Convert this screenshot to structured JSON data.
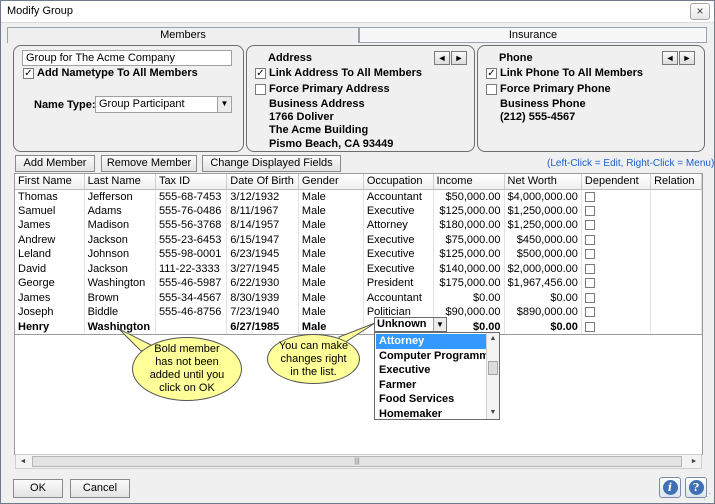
{
  "window": {
    "title": "Modify Group",
    "close_glyph": "×"
  },
  "tabs": [
    {
      "label": "Members",
      "active": true
    },
    {
      "label": "Insurance",
      "active": false
    }
  ],
  "group": {
    "name_value": "Group for The Acme Company",
    "add_nametype_label": "Add Nametype To All Members",
    "add_nametype_checked": true,
    "name_type_label": "Name Type:",
    "name_type_value": "Group Participant"
  },
  "address": {
    "title": "Address",
    "link_label": "Link Address To All Members",
    "link_checked": true,
    "primary_label": "Force Primary Address",
    "primary_checked": false,
    "type": "Business Address",
    "line1": "1766 Doliver",
    "line2": "The Acme Building",
    "line3": "Pismo Beach, CA  93449"
  },
  "phone": {
    "title": "Phone",
    "link_label": "Link Phone To All Members",
    "link_checked": true,
    "primary_label": "Force Primary Phone",
    "primary_checked": false,
    "type": "Business Phone",
    "number": "(212) 555-4567"
  },
  "toolbar": {
    "add_member": "Add Member",
    "remove_member": "Remove Member",
    "change_fields": "Change Displayed Fields",
    "hint": "(Left-Click = Edit, Right-Click = Menu)"
  },
  "table": {
    "columns": [
      "First Name",
      "Last Name",
      "Tax ID",
      "Date Of Birth",
      "Gender",
      "Occupation",
      "Income",
      "Net Worth",
      "Dependent",
      "Relation"
    ],
    "rows": [
      [
        "Thomas",
        "Jefferson",
        "555-68-7453",
        "3/12/1932",
        "Male",
        "Accountant",
        "$50,000.00",
        "$4,000,000.00"
      ],
      [
        "Samuel",
        "Adams",
        "555-76-0486",
        "8/11/1967",
        "Male",
        "Executive",
        "$125,000.00",
        "$1,250,000.00"
      ],
      [
        "James",
        "Madison",
        "555-56-3768",
        "8/14/1957",
        "Male",
        "Attorney",
        "$180,000.00",
        "$1,250,000.00"
      ],
      [
        "Andrew",
        "Jackson",
        "555-23-6453",
        "6/15/1947",
        "Male",
        "Executive",
        "$75,000.00",
        "$450,000.00"
      ],
      [
        "Leland",
        "Johnson",
        "555-98-0001",
        "6/23/1945",
        "Male",
        "Executive",
        "$125,000.00",
        "$500,000.00"
      ],
      [
        "David",
        "Jackson",
        "111-22-3333",
        "3/27/1945",
        "Male",
        "Executive",
        "$140,000.00",
        "$2,000,000.00"
      ],
      [
        "George",
        "Washington",
        "555-46-5987",
        "6/22/1930",
        "Male",
        "President",
        "$175,000.00",
        "$1,967,456.00"
      ],
      [
        "James",
        "Brown",
        "555-34-4567",
        "8/30/1939",
        "Male",
        "Accountant",
        "$0.00",
        "$0.00"
      ],
      [
        "Joseph",
        "Biddle",
        "555-46-8756",
        "7/23/1940",
        "Male",
        "Politician",
        "$90,000.00",
        "$890,000.00"
      ]
    ],
    "new_row": [
      "Henry",
      "Washington",
      "",
      "6/27/1985",
      "Male",
      "Unknown",
      "$0.00",
      "$0.00"
    ]
  },
  "occupation_dropdown": {
    "options": [
      "Attorney",
      "Computer Programmer",
      "Executive",
      "Farmer",
      "Food Services",
      "Homemaker"
    ],
    "selected": "Attorney"
  },
  "callouts": {
    "bold_member": "Bold member has not been added until you click on OK",
    "edit_in_list": "You can make changes right in the list."
  },
  "footer": {
    "ok": "OK",
    "cancel": "Cancel"
  },
  "icons": {
    "arrow_left": "◄",
    "arrow_right": "►",
    "checkmark": "✓",
    "dropdown": "▼",
    "info": "i",
    "help": "?"
  },
  "colors": {
    "hint": "#1a5fd1",
    "callout": "#ffff99",
    "selection": "#3399ff"
  }
}
